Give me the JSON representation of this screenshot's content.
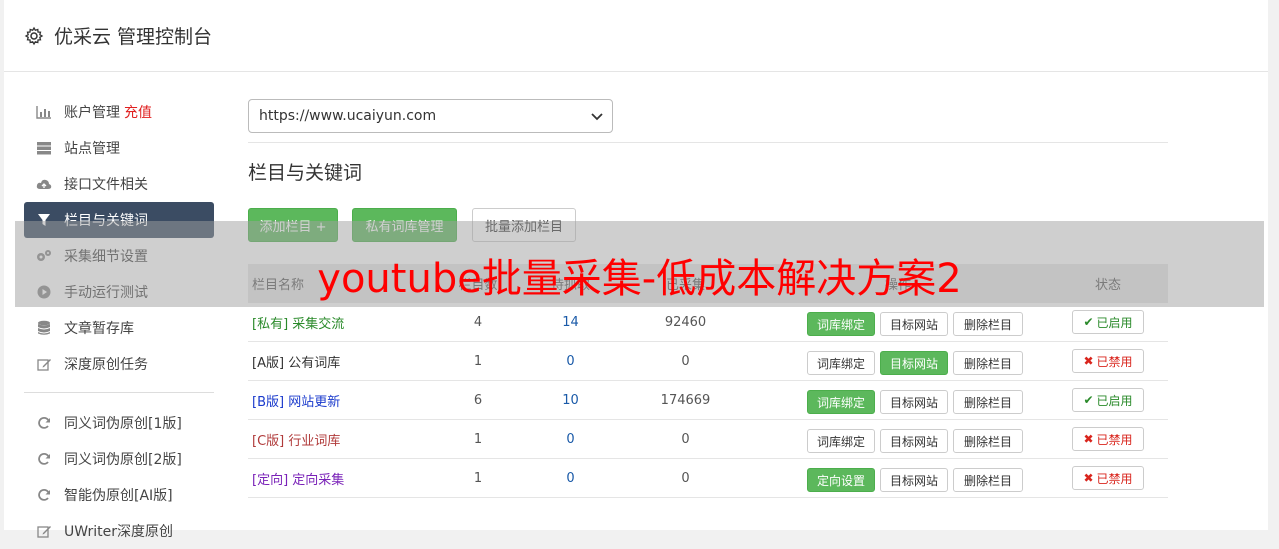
{
  "header": {
    "title": "优采云 管理控制台",
    "icon": "gear-icon"
  },
  "sidebar": {
    "items": [
      {
        "label": "账户管理",
        "extra": "充值",
        "icon": "bar-chart-icon",
        "active": false
      },
      {
        "label": "站点管理",
        "icon": "server-icon",
        "active": false
      },
      {
        "label": "接口文件相关",
        "icon": "cloud-upload-icon",
        "active": false
      },
      {
        "label": "栏目与关键词",
        "icon": "filter-icon",
        "active": true
      },
      {
        "label": "采集细节设置",
        "icon": "gears-icon",
        "active": false
      },
      {
        "label": "手动运行测试",
        "icon": "play-circle-icon",
        "active": false
      },
      {
        "label": "文章暂存库",
        "icon": "database-icon",
        "active": false
      },
      {
        "label": "深度原创任务",
        "icon": "edit-icon",
        "active": false
      }
    ],
    "items2": [
      {
        "label": "同义词伪原创[1版]",
        "icon": "refresh-icon"
      },
      {
        "label": "同义词伪原创[2版]",
        "icon": "refresh-icon"
      },
      {
        "label": "智能伪原创[AI版]",
        "icon": "refresh-icon"
      },
      {
        "label": "UWriter深度原创",
        "icon": "edit-icon"
      }
    ]
  },
  "main": {
    "site_select": {
      "value": "https://www.ucaiyun.com"
    },
    "section_title": "栏目与关键词",
    "buttons": {
      "add_column": "添加栏目 +",
      "private_lib": "私有词库管理",
      "batch_add": "批量添加栏目"
    }
  },
  "table": {
    "headers": {
      "name": "栏目名称",
      "n1": "栏目数",
      "n2": "待抓取",
      "n3": "已采集",
      "ops": "操作",
      "status": "状态"
    },
    "rows": [
      {
        "tag": "[私有]",
        "name": "采集交流",
        "n1": "4",
        "n2": "14",
        "n3": "92460",
        "op1": "词库绑定",
        "op1_green": true,
        "op2": "目标网站",
        "op2_green": false,
        "op3": "删除栏目",
        "status": "已启用",
        "enabled": true,
        "name_color": "#2a8a2a"
      },
      {
        "tag": "[A版]",
        "name": "公有词库",
        "n1": "1",
        "n2": "0",
        "n3": "0",
        "op1": "词库绑定",
        "op1_green": false,
        "op2": "目标网站",
        "op2_green": true,
        "op3": "删除栏目",
        "status": "已禁用",
        "enabled": false,
        "name_color": "#333333"
      },
      {
        "tag": "[B版]",
        "name": "网站更新",
        "n1": "6",
        "n2": "10",
        "n3": "174669",
        "op1": "词库绑定",
        "op1_green": true,
        "op2": "目标网站",
        "op2_green": false,
        "op3": "删除栏目",
        "status": "已启用",
        "enabled": true,
        "name_color": "#1a3acc"
      },
      {
        "tag": "[C版]",
        "name": "行业词库",
        "n1": "1",
        "n2": "0",
        "n3": "0",
        "op1": "词库绑定",
        "op1_green": false,
        "op2": "目标网站",
        "op2_green": false,
        "op3": "删除栏目",
        "status": "已禁用",
        "enabled": false,
        "name_color": "#b03a3a"
      },
      {
        "tag": "[定向]",
        "name": "定向采集",
        "n1": "1",
        "n2": "0",
        "n3": "0",
        "op1": "定向设置",
        "op1_green": true,
        "op2": "目标网站",
        "op2_green": false,
        "op3": "删除栏目",
        "status": "已禁用",
        "enabled": false,
        "name_color": "#7a22b8"
      }
    ]
  },
  "watermark": "youtube批量采集-低成本解决方案2",
  "colors": {
    "green": "#5cb85c",
    "active_nav": "#3b4c63",
    "enabled": "#2a8a2a",
    "disabled": "#d9251d",
    "link_blue": "#1a5aa8"
  }
}
